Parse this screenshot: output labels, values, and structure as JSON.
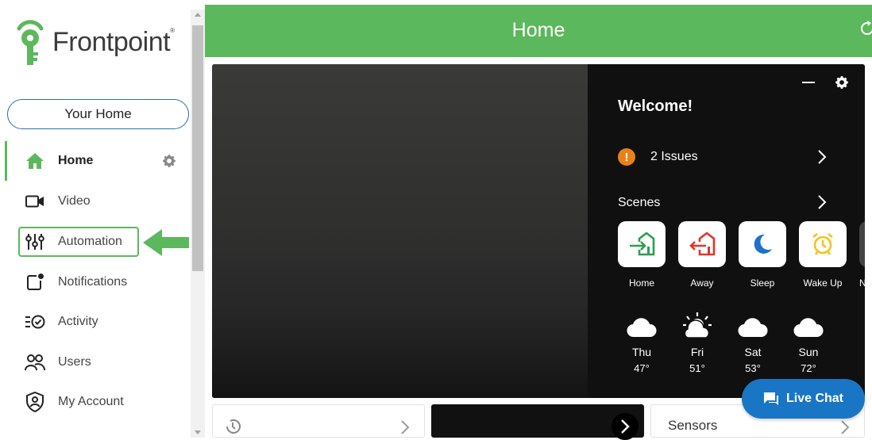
{
  "brand": {
    "name": "Frontpoint",
    "trademark": "®",
    "color": "#5cb85c"
  },
  "sidebar": {
    "home_selector": "Your Home",
    "items": [
      {
        "label": "Home",
        "icon": "home-icon",
        "active": true
      },
      {
        "label": "Video",
        "icon": "video-camera-icon"
      },
      {
        "label": "Automation",
        "icon": "sliders-icon",
        "highlighted": true
      },
      {
        "label": "Notifications",
        "icon": "notification-icon"
      },
      {
        "label": "Activity",
        "icon": "activity-list-icon"
      },
      {
        "label": "Users",
        "icon": "users-icon"
      },
      {
        "label": "My Account",
        "icon": "shield-user-icon"
      }
    ]
  },
  "header": {
    "title": "Home",
    "accent": "#5cb85c"
  },
  "welcome": {
    "title": "Welcome!",
    "issues_label": "2 Issues",
    "issue_badge": "!",
    "scenes_label": "Scenes",
    "scenes": [
      {
        "label": "Home",
        "icon": "arrive-home-icon",
        "color": "#2e9e4f"
      },
      {
        "label": "Away",
        "icon": "leave-home-icon",
        "color": "#e0352b"
      },
      {
        "label": "Sleep",
        "icon": "moon-icon",
        "color": "#1e73c8"
      },
      {
        "label": "Wake Up",
        "icon": "alarm-clock-icon",
        "color": "#f2c318"
      },
      {
        "label": "N",
        "icon": "scene-icon"
      }
    ],
    "weather": [
      {
        "day": "Thu",
        "temp": "47°",
        "icon": "cloud-icon"
      },
      {
        "day": "Fri",
        "temp": "51°",
        "icon": "partly-sunny-icon"
      },
      {
        "day": "Sat",
        "temp": "53°",
        "icon": "cloud-icon"
      },
      {
        "day": "Sun",
        "temp": "72°",
        "icon": "cloud-icon"
      }
    ]
  },
  "bottom_cards": {
    "sensors_label": "Sensors"
  },
  "live_chat": {
    "label": "Live Chat",
    "color": "#1976c5"
  }
}
